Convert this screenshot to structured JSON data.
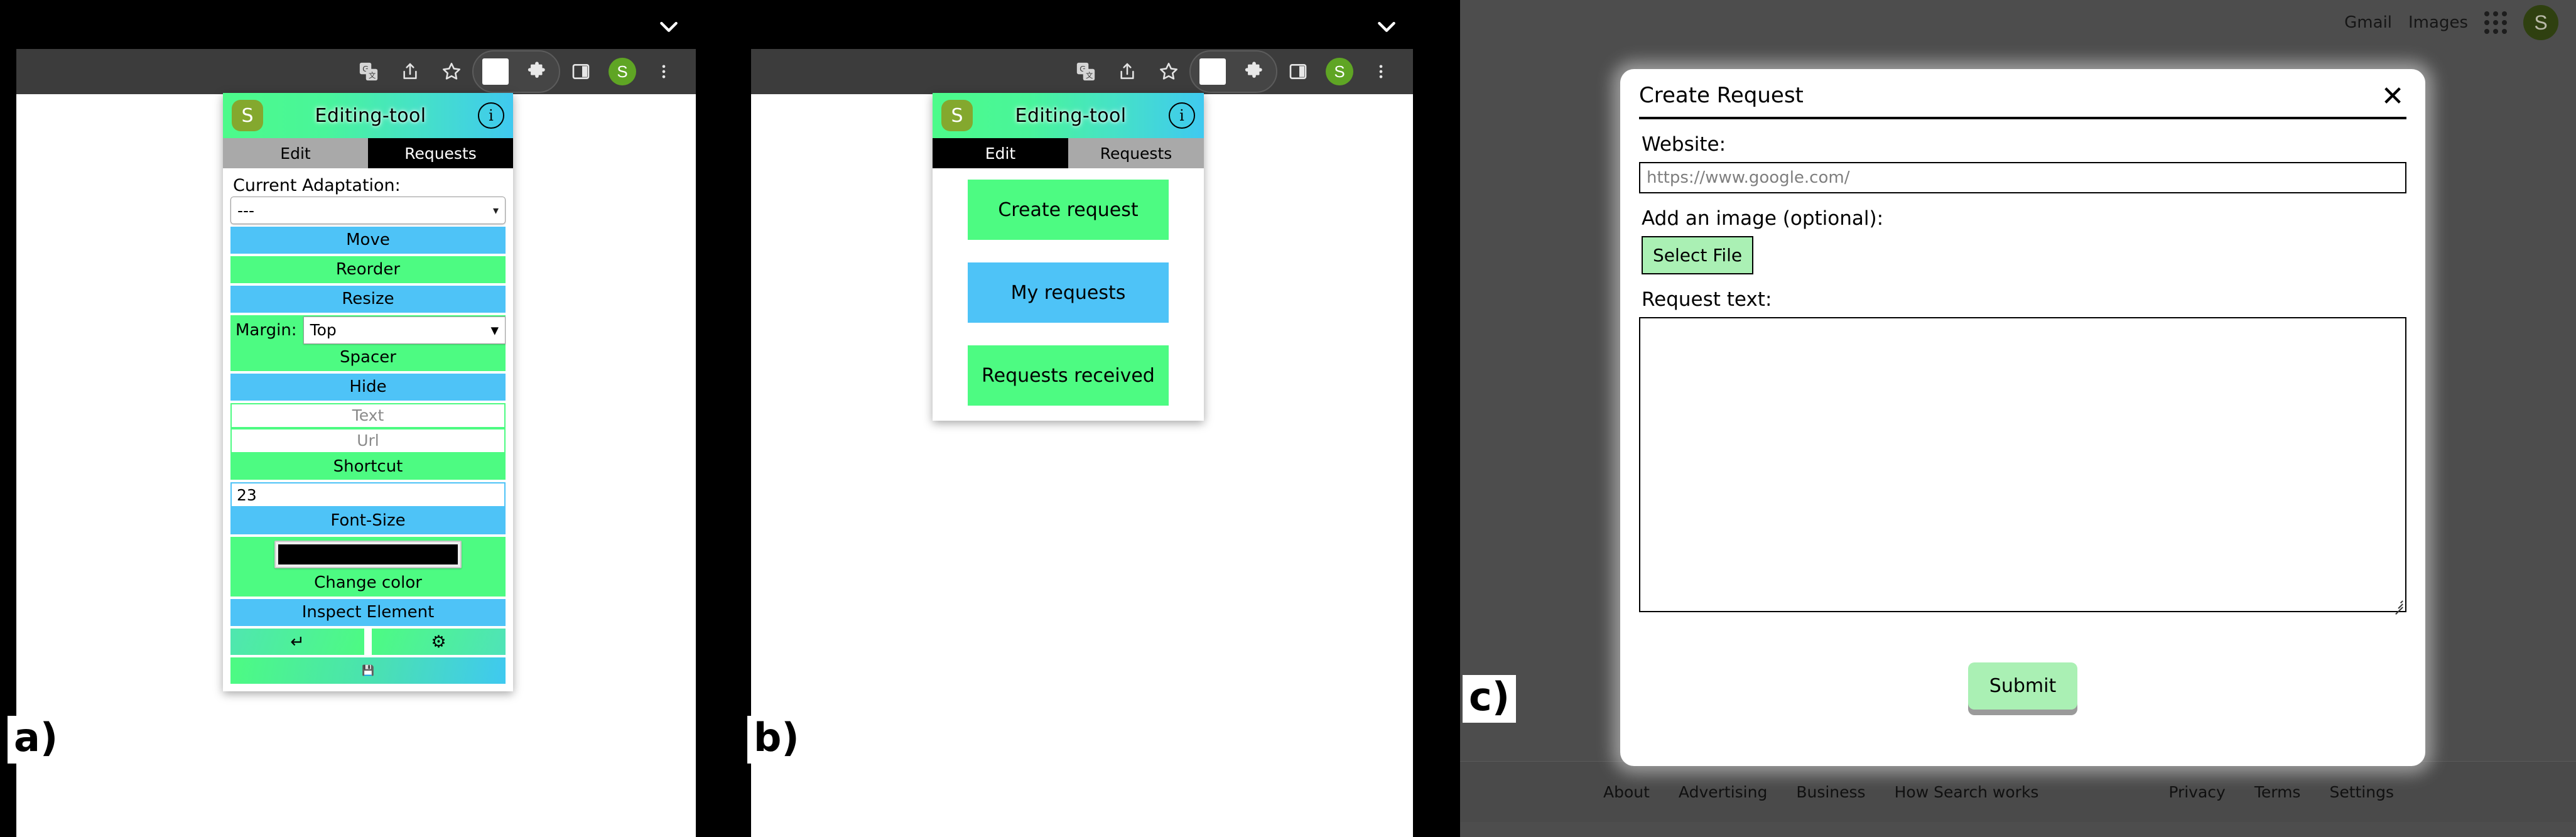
{
  "figure": {
    "labels": [
      "a)",
      "b)",
      "c)"
    ]
  },
  "browser": {
    "chevron_icon": "chevron-down-icon",
    "toolbar_icons": [
      "translate-icon",
      "share-icon",
      "bookmark-star-icon",
      "extension-white-square-icon",
      "puzzle-piece-extensions-icon",
      "side-panel-icon"
    ],
    "avatar_letter": "S",
    "menu_icon": "three-dot-menu-icon"
  },
  "popup": {
    "logo_letter": "S",
    "title": "Editing-tool",
    "info_icon": "info-icon",
    "tabs": [
      {
        "label": "Edit",
        "state_a": "inactive",
        "state_b": "active"
      },
      {
        "label": "Requests",
        "state_a": "active",
        "state_b": "inactive"
      }
    ]
  },
  "edit_tab": {
    "current_adaptation_label": "Current Adaptation:",
    "current_adaptation_value": "---",
    "buttons": {
      "move": "Move",
      "reorder": "Reorder",
      "resize": "Resize",
      "spacer": "Spacer",
      "hide": "Hide",
      "shortcut": "Shortcut",
      "font_size": "Font-Size",
      "change_color": "Change color",
      "inspect_element": "Inspect Element"
    },
    "margin_label": "Margin:",
    "margin_value": "Top",
    "text_placeholder": "Text",
    "url_placeholder": "Url",
    "font_size_value": "23",
    "color_value": "#000000",
    "icon_buttons": [
      {
        "name": "undo-icon",
        "glyph": "↵"
      },
      {
        "name": "settings-gear-icon",
        "glyph": "⚙"
      },
      {
        "name": "save-floppy-icon",
        "glyph": "💾"
      }
    ]
  },
  "requests_tab": {
    "buttons": [
      {
        "label": "Create request",
        "color": "green"
      },
      {
        "label": "My requests",
        "color": "blue"
      },
      {
        "label": "Requests received",
        "color": "green"
      }
    ]
  },
  "google": {
    "header_links": [
      "Gmail",
      "Images"
    ],
    "apps_icon": "apps-grid-icon",
    "avatar_letter": "S",
    "footer_left": [
      "About",
      "Advertising",
      "Business",
      "How Search works"
    ],
    "footer_right": [
      "Privacy",
      "Terms",
      "Settings"
    ]
  },
  "modal": {
    "title": "Create Request",
    "close_icon": "close-x-icon",
    "website_label": "Website:",
    "website_placeholder": "https://www.google.com/",
    "image_label": "Add an image (optional):",
    "select_file_label": "Select File",
    "request_text_label": "Request text:",
    "request_text_value": "",
    "submit_label": "Submit"
  },
  "colors": {
    "accent_green": "#4dfb82",
    "accent_blue": "#4ec3f7",
    "header_gradient_from": "#4dfb8a",
    "header_gradient_to": "#3fc9f0",
    "logo_olive": "#84a82e",
    "page_backdrop": "#4d4d4d",
    "submit_green": "#aaf0b4"
  }
}
